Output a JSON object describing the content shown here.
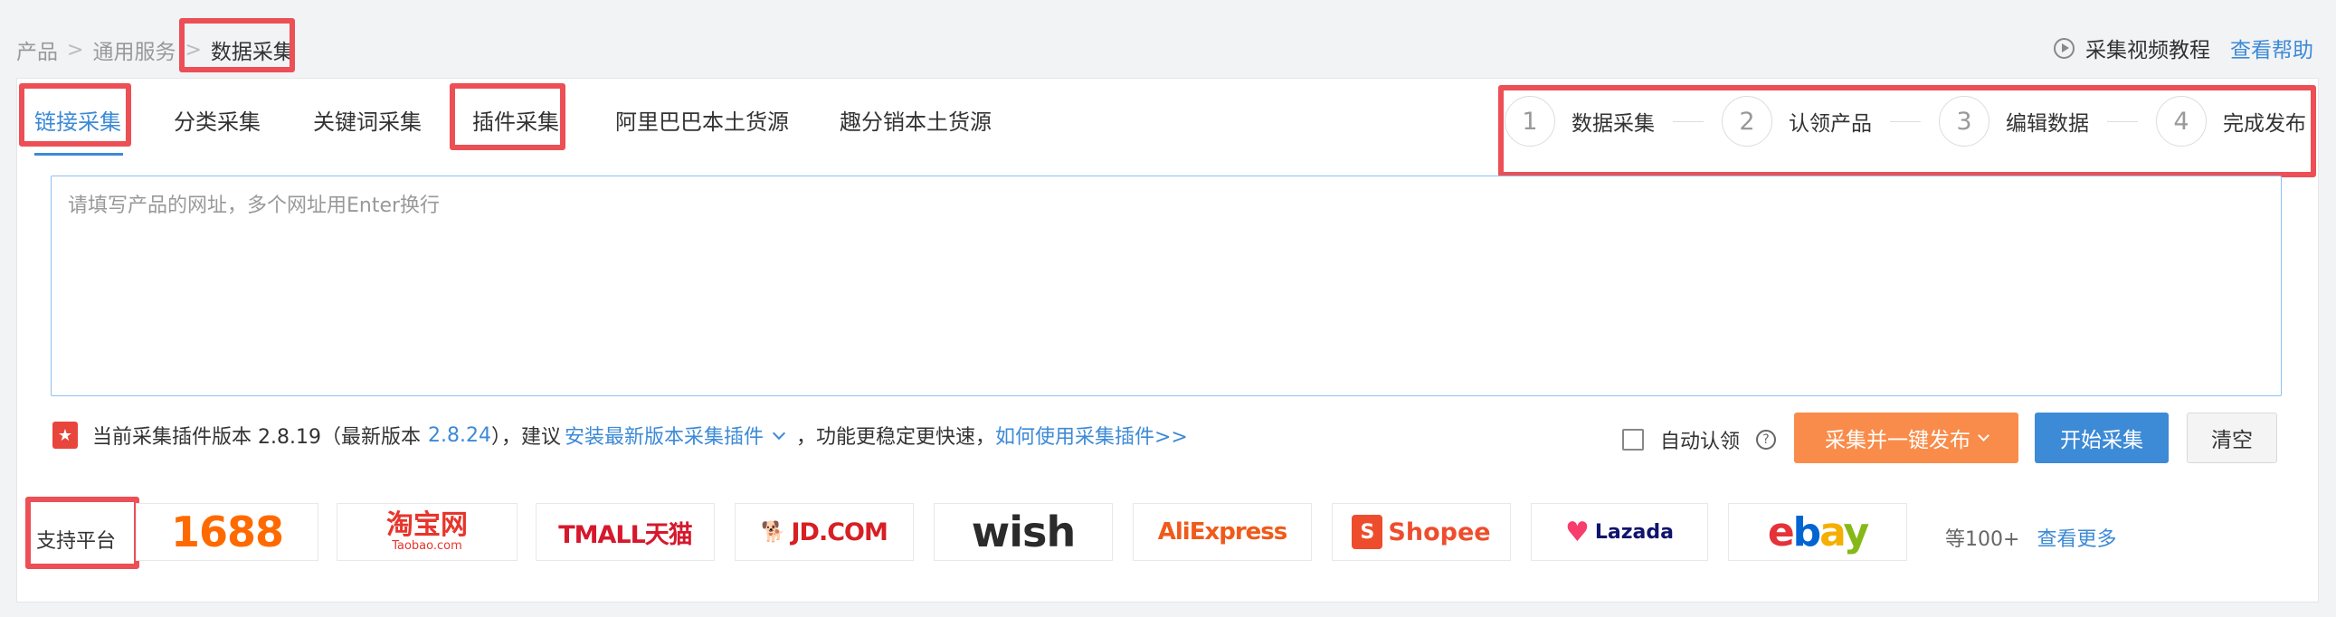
{
  "breadcrumb": {
    "items": [
      "产品",
      "通用服务"
    ],
    "current": "数据采集",
    "separator": ">"
  },
  "top_links": {
    "tutorial": "采集视频教程",
    "help": "查看帮助"
  },
  "tabs": [
    {
      "label": "链接采集",
      "active": true
    },
    {
      "label": "分类采集"
    },
    {
      "label": "关键词采集"
    },
    {
      "label": "插件采集"
    },
    {
      "label": "阿里巴巴本土货源"
    },
    {
      "label": "趣分销本土货源"
    }
  ],
  "steps": [
    {
      "num": "1",
      "label": "数据采集"
    },
    {
      "num": "2",
      "label": "认领产品"
    },
    {
      "num": "3",
      "label": "编辑数据"
    },
    {
      "num": "4",
      "label": "完成发布"
    }
  ],
  "url_input": {
    "placeholder": "请填写产品的网址，多个网址用Enter换行",
    "value": ""
  },
  "plugin_info": {
    "prefix": "当前采集插件版本 2.8.19（最新版本",
    "latest": "2.8.24",
    "suffix1": "），建议",
    "install_link": "安装最新版本采集插件",
    "suffix2": "，功能更稳定更快速，",
    "howto_link": "如何使用采集插件>>"
  },
  "auto_claim": {
    "label": "自动认领",
    "checked": false
  },
  "buttons": {
    "collect_publish": "采集并一键发布",
    "start": "开始采集",
    "clear": "清空"
  },
  "platforms": {
    "label": "支持平台",
    "items": [
      "1688",
      "淘宝网",
      "Taobao.com",
      "TMALL天猫",
      "JD.COM",
      "wish",
      "AliExpress",
      "Shopee",
      "Lazada",
      "ebay"
    ],
    "more_count": "等100+",
    "more_link": "查看更多"
  },
  "colors": {
    "accent": "#3d8ad6",
    "orange": "#f98c4a",
    "highlight": "#ec4f55"
  }
}
